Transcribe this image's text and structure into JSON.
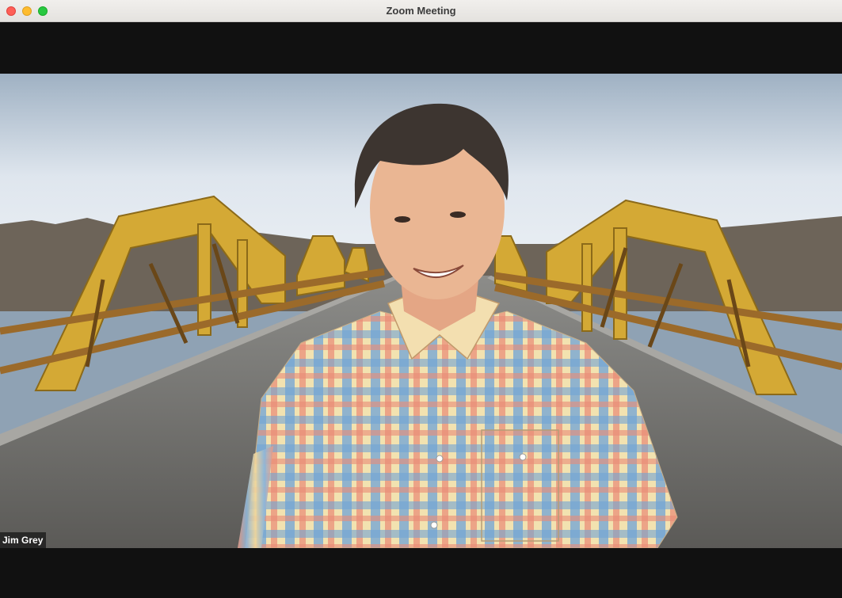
{
  "window": {
    "title": "Zoom Meeting",
    "controls": [
      "close",
      "minimize",
      "maximize"
    ]
  },
  "participant": {
    "name": "Jim Grey",
    "background": "virtual background - yellow truss bridge",
    "colors": {
      "bridge": "#d9b23a",
      "sky": "#c9d6e2",
      "road": "#6f6e6b"
    }
  }
}
